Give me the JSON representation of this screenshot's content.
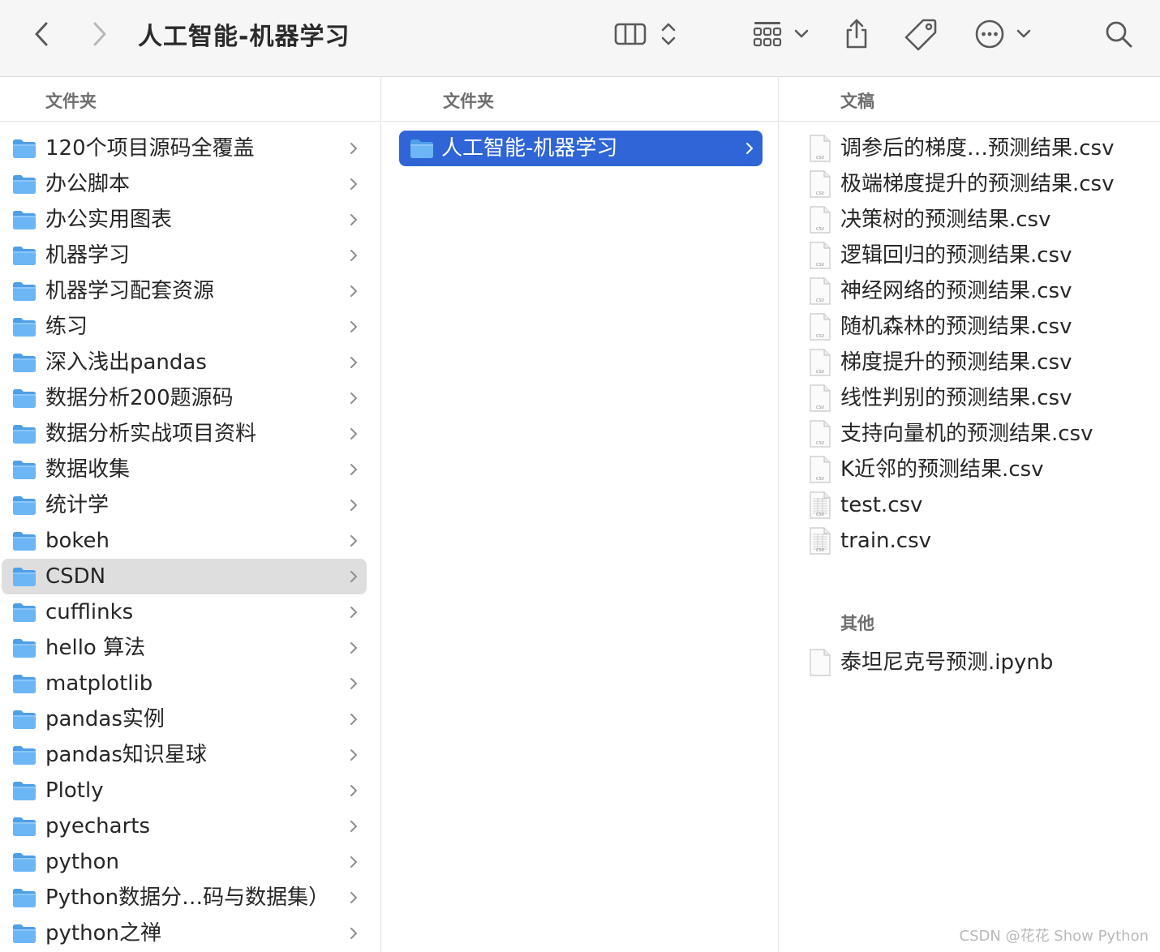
{
  "toolbar": {
    "title": "人工智能-机器学习",
    "back_icon": "chevron-left-icon",
    "forward_icon": "chevron-right-icon",
    "view_icon": "column-view-icon",
    "group_icon": "grid-view-icon",
    "share_icon": "share-icon",
    "tag_icon": "tag-icon",
    "more_icon": "ellipsis-circle-icon",
    "search_icon": "search-icon"
  },
  "columns": [
    {
      "header": "文件夹",
      "items": [
        {
          "label": "120个项目源码全覆盖"
        },
        {
          "label": "办公脚本"
        },
        {
          "label": "办公实用图表"
        },
        {
          "label": "机器学习"
        },
        {
          "label": "机器学习配套资源"
        },
        {
          "label": "练习"
        },
        {
          "label": "深入浅出pandas"
        },
        {
          "label": "数据分析200题源码"
        },
        {
          "label": "数据分析实战项目资料"
        },
        {
          "label": "数据收集"
        },
        {
          "label": "统计学"
        },
        {
          "label": "bokeh"
        },
        {
          "label": "CSDN"
        },
        {
          "label": "cufflinks"
        },
        {
          "label": "hello 算法"
        },
        {
          "label": "matplotlib"
        },
        {
          "label": "pandas实例"
        },
        {
          "label": "pandas知识星球"
        },
        {
          "label": "Plotly"
        },
        {
          "label": "pyecharts"
        },
        {
          "label": "python"
        },
        {
          "label": "Python数据分…码与数据集）"
        },
        {
          "label": "python之禅"
        }
      ],
      "highlighted": "CSDN"
    },
    {
      "header": "文件夹",
      "items": [
        {
          "label": "人工智能-机器学习"
        }
      ],
      "selected": "人工智能-机器学习"
    },
    {
      "header": "文稿",
      "items": [
        {
          "label": "调参后的梯度…预测结果.csv"
        },
        {
          "label": "极端梯度提升的预测结果.csv"
        },
        {
          "label": "决策树的预测结果.csv"
        },
        {
          "label": "逻辑回归的预测结果.csv"
        },
        {
          "label": "神经网络的预测结果.csv"
        },
        {
          "label": "随机森林的预测结果.csv"
        },
        {
          "label": "梯度提升的预测结果.csv"
        },
        {
          "label": "线性判别的预测结果.csv"
        },
        {
          "label": "支持向量机的预测结果.csv"
        },
        {
          "label": "K近邻的预测结果.csv"
        },
        {
          "label": "test.csv"
        },
        {
          "label": "train.csv"
        }
      ],
      "file_badge": "CSV",
      "other_header": "其他",
      "other_items": [
        {
          "label": "泰坦尼克号预测.ipynb"
        }
      ]
    }
  ],
  "colors": {
    "selection": "#2f65d6",
    "highlight": "#dedede",
    "folder": "#5aa9ef",
    "toolbar_bg": "#f6f6f6"
  },
  "watermark": "CSDN @花花 Show Python"
}
